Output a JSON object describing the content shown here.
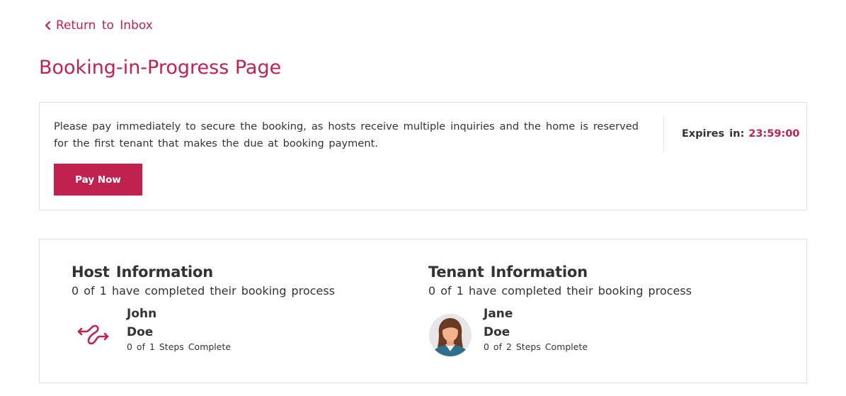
{
  "nav": {
    "back_label": "Return to Inbox"
  },
  "page": {
    "title": "Booking-in-Progress Page"
  },
  "notice": {
    "message": "Please pay immediately to secure the booking, as hosts receive multiple inquiries and the home is reserved for the first tenant that makes the due at booking payment.",
    "pay_button_label": "Pay Now",
    "expires_label": "Expires in:",
    "expires_value": "23:59:00"
  },
  "host": {
    "heading": "Host Information",
    "progress_text": "0 of 1 have completed their booking process",
    "first_name": "John",
    "last_name": "Doe",
    "steps_text": "0 of 1 Steps Complete",
    "avatar_icon": "infinity-logo-icon"
  },
  "tenant": {
    "heading": "Tenant Information",
    "progress_text": "0 of 1 have completed their booking process",
    "first_name": "Jane",
    "last_name": "Doe",
    "steps_text": "0 of 2 Steps Complete",
    "avatar_icon": "female-avatar-icon"
  },
  "colors": {
    "accent": "#c0214f",
    "text": "#333333",
    "border": "#dddddd"
  }
}
